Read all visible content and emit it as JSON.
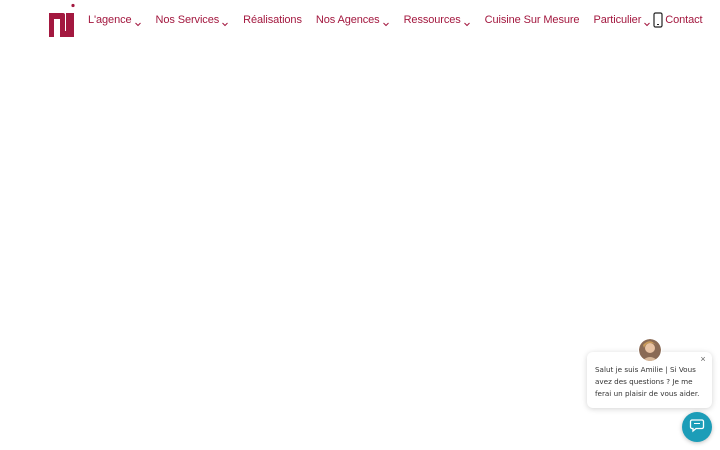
{
  "header": {
    "nav": [
      {
        "label": "L'agence",
        "has_dropdown": true
      },
      {
        "label": "Nos Services",
        "has_dropdown": true
      },
      {
        "label": "Réalisations",
        "has_dropdown": false
      },
      {
        "label": "Nos Agences",
        "has_dropdown": true
      },
      {
        "label": "Ressources",
        "has_dropdown": true
      },
      {
        "label": "Cuisine Sur Mesure",
        "has_dropdown": false
      },
      {
        "label": "Particulier",
        "has_dropdown": true
      },
      {
        "label": "Contact",
        "has_dropdown": false
      }
    ],
    "icons": {
      "logo": "brand-logo",
      "mobile": "mobile-phone-icon"
    }
  },
  "chat": {
    "message": "Salut je suis Amilie | Si Vous avez des questions ? Je me ferai un plaisir de vous aider.",
    "close_glyph": "×"
  },
  "colors": {
    "brand": "#a3183f",
    "chat_launcher": "#1c9db8",
    "background": "#ffffff"
  }
}
